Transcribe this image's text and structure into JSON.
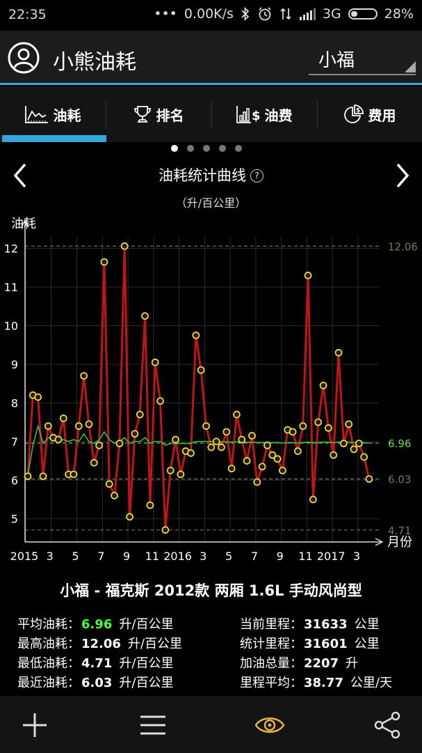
{
  "status": {
    "time": "22:35",
    "net": "0.00K/s",
    "network": "3G",
    "battery": "28%"
  },
  "app": {
    "title": "小熊油耗",
    "user": "小福"
  },
  "tabs": [
    {
      "label": "油耗",
      "icon": "chart-icon"
    },
    {
      "label": "排名",
      "icon": "trophy-icon"
    },
    {
      "label": "油费",
      "icon": "money-chart-icon"
    },
    {
      "label": "费用",
      "icon": "pie-chart-icon"
    }
  ],
  "page_dots": 5,
  "active_dot": 0,
  "chart_heading": {
    "title": "油耗统计曲线",
    "help": "?",
    "unit": "（升/百公里）"
  },
  "chart_data": {
    "type": "line",
    "title": "油耗统计曲线",
    "ylabel": "油耗",
    "xlabel": "月份",
    "ylim": [
      4.4,
      12.3
    ],
    "yticks": [
      5,
      6,
      7,
      8,
      9,
      10,
      11,
      12
    ],
    "xticks": [
      "2015",
      "3",
      "5",
      "7",
      "9",
      "11",
      "2016",
      "3",
      "5",
      "7",
      "9",
      "11",
      "2017",
      "3"
    ],
    "reference_lines": [
      {
        "label": "12.06",
        "value": 12.06,
        "color": "#7a7a50"
      },
      {
        "label": "6.96",
        "value": 6.96,
        "color": "#6be04d"
      },
      {
        "label": "6.03",
        "value": 6.03,
        "color": "#7a7a50"
      },
      {
        "label": "4.71",
        "value": 4.71,
        "color": "#7a7a50"
      }
    ],
    "series": [
      {
        "name": "油耗",
        "color": "#c0141a",
        "values": [
          6.1,
          8.2,
          8.15,
          6.1,
          7.4,
          7.1,
          7.05,
          7.6,
          6.15,
          6.15,
          7.4,
          8.7,
          7.45,
          6.45,
          6.9,
          11.65,
          5.9,
          5.6,
          6.95,
          12.06,
          5.05,
          7.2,
          7.7,
          10.25,
          5.35,
          9.05,
          8.05,
          4.71,
          6.25,
          7.05,
          6.15,
          6.75,
          6.7,
          9.75,
          8.85,
          7.4,
          6.85,
          7.0,
          6.85,
          7.25,
          6.3,
          7.7,
          7.05,
          6.5,
          7.15,
          5.95,
          6.35,
          6.9,
          6.65,
          6.55,
          6.25,
          7.3,
          7.25,
          6.75,
          7.4,
          11.3,
          5.5,
          7.5,
          8.45,
          7.35,
          6.65,
          9.3,
          6.95,
          7.45,
          6.8,
          6.95,
          6.6,
          6.03
        ]
      },
      {
        "name": "平均",
        "color": "#35c94a",
        "values": [
          6.1,
          6.9,
          7.4,
          6.95,
          7.1,
          7.05,
          7.0,
          7.05,
          7.0,
          7.05,
          7.0,
          7.2,
          7.0,
          6.95,
          7.05,
          7.25,
          7.05,
          6.95,
          7.0,
          7.1,
          6.95,
          7.0,
          7.0,
          7.1,
          6.95,
          7.0,
          7.0,
          6.9,
          6.95,
          6.95,
          6.95,
          6.95,
          6.95,
          7.0,
          7.0,
          7.0,
          7.0,
          7.0,
          6.99,
          6.99,
          6.98,
          6.99,
          6.98,
          6.98,
          6.98,
          6.97,
          6.97,
          6.97,
          6.97,
          6.97,
          6.96,
          6.97,
          6.97,
          6.96,
          6.97,
          6.98,
          6.97,
          6.97,
          6.98,
          6.98,
          6.97,
          6.98,
          6.98,
          6.98,
          6.97,
          6.97,
          6.97,
          6.96
        ]
      }
    ]
  },
  "car": "小福 - 福克斯 2012款 两厢 1.6L 手动风尚型",
  "stats_left": [
    {
      "label": "平均油耗：",
      "value": "6.96",
      "unit": "升/百公里",
      "color": "#4cff3a"
    },
    {
      "label": "最高油耗：",
      "value": "12.06",
      "unit": "升/百公里",
      "color": "#ffffff"
    },
    {
      "label": "最低油耗：",
      "value": "4.71",
      "unit": "升/百公里",
      "color": "#ffffff"
    },
    {
      "label": "最近油耗：",
      "value": "6.03",
      "unit": "升/百公里",
      "color": "#ffffff"
    }
  ],
  "stats_right": [
    {
      "label": "当前里程：",
      "value": "31633",
      "unit": "公里"
    },
    {
      "label": "统计里程：",
      "value": "31601",
      "unit": "公里"
    },
    {
      "label": "加油总量：",
      "value": "2207",
      "unit": "升"
    },
    {
      "label": "里程平均：",
      "value": "38.77",
      "unit": "公里/天"
    }
  ],
  "bottom_actions": [
    {
      "name": "add-button",
      "icon": "plus-icon"
    },
    {
      "name": "menu-button",
      "icon": "menu-icon"
    },
    {
      "name": "view-button",
      "icon": "eye-icon"
    },
    {
      "name": "share-button",
      "icon": "share-icon"
    }
  ],
  "colors": {
    "accent": "#35a7d8",
    "line": "#c0141a",
    "marker": "#e8d84a",
    "avg": "#35c94a"
  }
}
